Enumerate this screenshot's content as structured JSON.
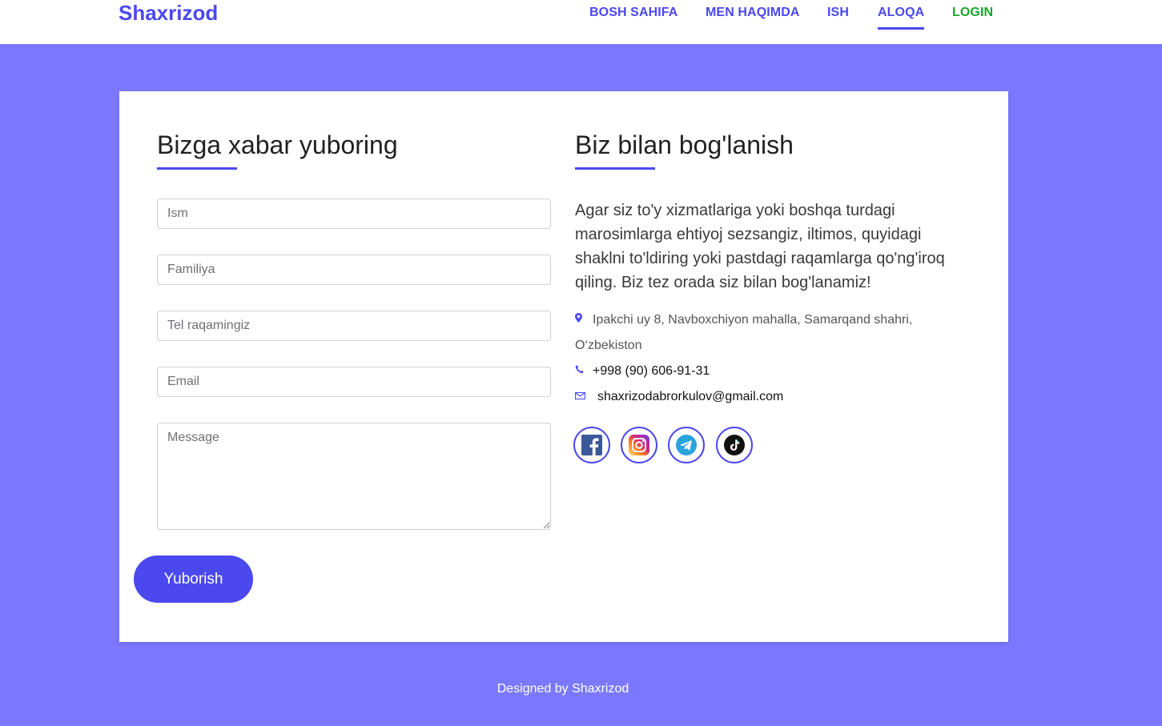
{
  "nav": {
    "brand": "Shaxrizod",
    "items": [
      {
        "label": "BOSH SAHIFA"
      },
      {
        "label": "MEN HAQIMDA"
      },
      {
        "label": "ISH"
      },
      {
        "label": "ALOQA",
        "active": true
      },
      {
        "label": "LOGIN"
      }
    ]
  },
  "form": {
    "heading": "Bizga xabar yuboring",
    "fields": {
      "name_placeholder": "Ism",
      "surname_placeholder": "Familiya",
      "phone_placeholder": "Tel raqamingiz",
      "email_placeholder": "Email",
      "message_placeholder": "Message"
    },
    "submit_label": "Yuborish"
  },
  "contact": {
    "heading": "Biz bilan bog'lanish",
    "description": "Agar siz to'y xizmatlariga yoki boshqa turdagi marosimlarga ehtiyoj sezsangiz, iltimos, quyidagi shaklni to'ldiring yoki pastdagi raqamlarga qo'ng'iroq qiling. Biz tez orada siz bilan bog'lanamiz!",
    "address": "Ipakchi uy 8, Navboxchiyon mahalla, Samarqand shahri, O‘zbekiston",
    "phone": "+998 (90) 606-91-31",
    "email": "shaxrizodabrorkulov@gmail.com",
    "icons": {
      "address": "map-marker-icon",
      "phone": "phone-icon",
      "email": "envelope-icon"
    },
    "socials": [
      "facebook-icon",
      "instagram-icon",
      "telegram-icon",
      "tiktok-icon"
    ]
  },
  "footer": {
    "text": "Designed by Shaxrizod"
  },
  "colors": {
    "accent": "#4b48ee",
    "page_background": "#7b78ff",
    "login": "#1aa62a"
  }
}
